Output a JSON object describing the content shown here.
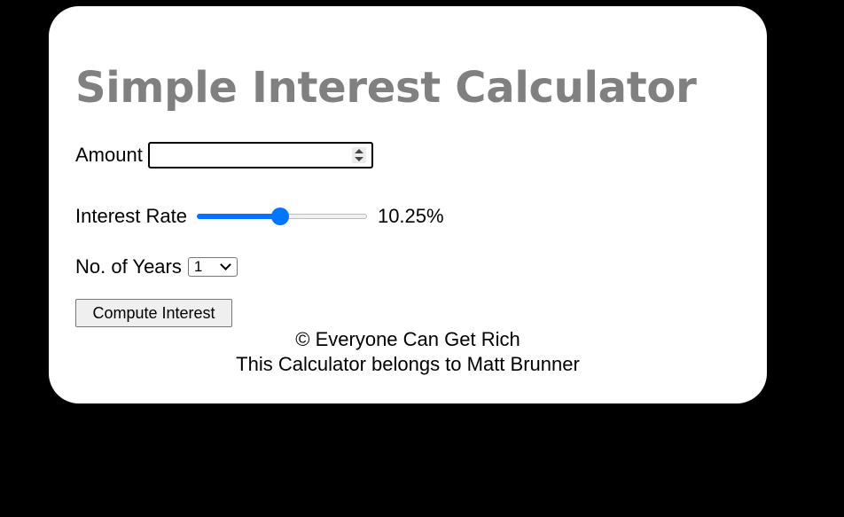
{
  "calculator": {
    "title": "Simple Interest Calculator",
    "amount": {
      "label": "Amount",
      "value": ""
    },
    "interest_rate": {
      "label": "Interest Rate",
      "value_text": "10.25%",
      "slider_fraction": 0.49,
      "accent_color": "#0075ff"
    },
    "years": {
      "label": "No. of Years",
      "selected": "1"
    },
    "compute_button": "Compute Interest",
    "footer": {
      "copyright": "© Everyone Can Get Rich",
      "owner": "This Calculator belongs to Matt Brunner"
    }
  }
}
